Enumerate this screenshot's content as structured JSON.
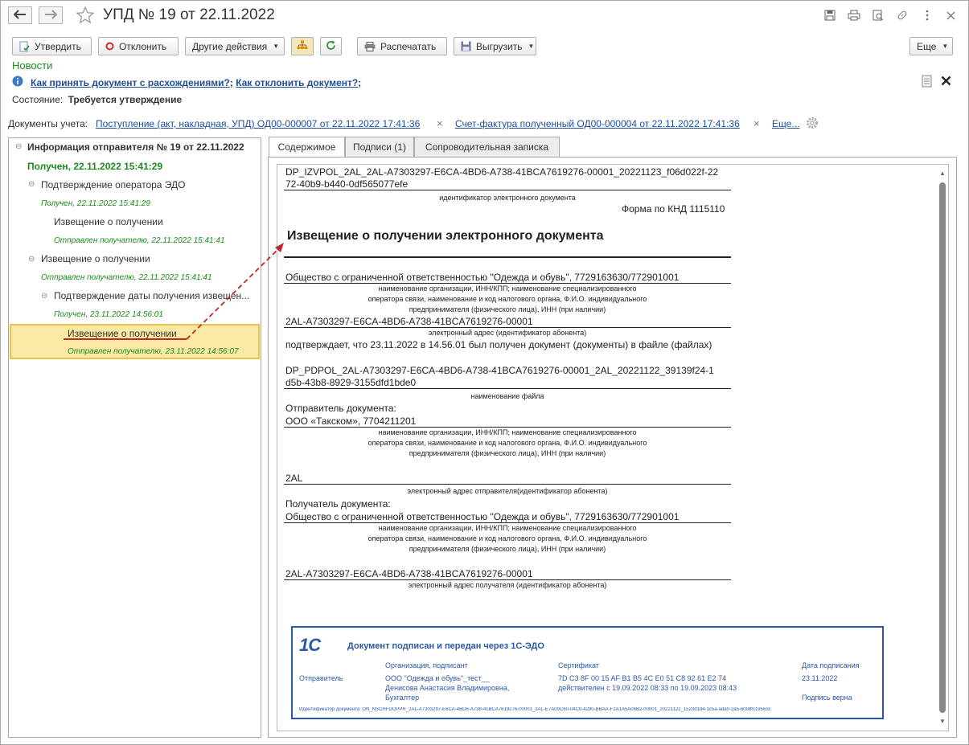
{
  "window": {
    "title": "УПД № 19 от 22.11.2022",
    "icons": [
      "back-arrow-icon",
      "forward-arrow-icon",
      "star-icon",
      "save-icon",
      "print-icon",
      "preview-icon",
      "link-icon",
      "more-vert-icon",
      "close-icon"
    ]
  },
  "toolbar": {
    "approve": "Утвердить",
    "reject": "Отклонить",
    "other_actions": "Другие действия",
    "print": "Распечатать",
    "export": "Выгрузить",
    "more": "Еще"
  },
  "news": {
    "label": "Новости",
    "link1": "Как принять документ с расхождениями?",
    "sep1": ";",
    "link2": "Как отклонить документ?",
    "sep2": ";"
  },
  "state": {
    "label": "Состояние:",
    "value": "Требуется утверждение"
  },
  "docs": {
    "label": "Документы учета:",
    "doc1": "Поступление (акт, накладная, УПД) ОД00-000007 от 22.11.2022 17:41:36",
    "doc2": "Счет-фактура полученный ОД00-000004 от 22.11.2022 17:41:36",
    "more": "Еще..."
  },
  "tree": {
    "root": "Информация отправителя № 19 от 22.11.2022",
    "root_status": "Получен, 22.11.2022 15:41:29",
    "n1": "Подтверждение оператора ЭДО",
    "n1_status": "Получен, 22.11.2022 15:41:29",
    "n1a": "Извещение о получении",
    "n1a_status": "Отправлен получателю, 22.11.2022 15:41:41",
    "n2": "Извещение о получении",
    "n2_status": "Отправлен получателю, 22.11.2022 15:41:41",
    "n3": "Подтверждение даты получения извещен...",
    "n3_status": "Получен, 23.11.2022 14:56:01",
    "n3a": "Извещение о получении",
    "n3a_status": "Отправлен получателю, 23.11.2022 14:56:07"
  },
  "tabs": [
    "Содержимое",
    "Подписи (1)",
    "Сопроводительная записка"
  ],
  "document": {
    "file_id_1": "DP_IZVPOL_2AL_2AL-A7303297-E6CA-4BD6-A738-41BCA7619276-00001_20221123_f06d022f-22",
    "file_id_2": "72-40b9-b440-0df565077efe",
    "file_id_caption": "идентификатор электронного документа",
    "form": "Форма по КНД 1115110",
    "heading": "Извещение о получении электронного документа",
    "org": "Общество с ограниченной ответственностью \"Одежда и обувь\", 7729163630/772901001",
    "org_caption_1": "наименование организации, ИНН/КПП; наименование специализированного",
    "org_caption_2": "оператора связи, наименование и код налогового органа, Ф.И.О. индивидуального",
    "org_caption_3": "предпринимателя (физического лица), ИНН (при наличии)",
    "address": "2AL-A7303297-E6CA-4BD6-A738-41BCA7619276-00001",
    "address_caption": "электронный адрес (идентификатор абонента)",
    "confirm": "подтверждает, что 23.11.2022 в 14.56.01 был получен документ (документы) в файле (файлах)",
    "file_1": "DP_PDPOL_2AL-A7303297-E6CA-4BD6-A738-41BCA7619276-00001_2AL_20221122_39139f24-1",
    "file_2": "d5b-43b8-8929-3155dfd1bde0",
    "file_caption": "наименование файла",
    "sender_label": "Отправитель документа:",
    "sender": "ООО «Такском», 7704211201",
    "sender_caption_1": "наименование организации, ИНН/КПП; наименование специализированного",
    "sender_caption_2": "оператора связи, наименование и код налогового органа, Ф.И.О. индивидуального",
    "sender_caption_3": "предпринимателя (физического лица), ИНН (при наличии)",
    "sender_addr": "2AL",
    "sender_addr_caption": "электронный адрес отправителя(идентификатор абонента)",
    "recipient_label": "Получатель документа:",
    "recipient": "Общество с ограниченной ответственностью \"Одежда и обувь\", 7729163630/772901001",
    "recipient_caption_1": "наименование организации, ИНН/КПП; наименование специализированного",
    "recipient_caption_2": "оператора связи, наименование и код налогового органа, Ф.И.О. индивидуального",
    "recipient_caption_3": "предпринимателя (физического лица), ИНН (при наличии)",
    "recipient_addr": "2AL-A7303297-E6CA-4BD6-A738-41BCA7619276-00001",
    "recipient_addr_caption": "электронный адрес получателя (идентификатор абонента)"
  },
  "stamp": {
    "logo": "1С",
    "title": "Документ подписан и передан через 1С-ЭДО",
    "col_org": "Организация, подписант",
    "col_cert": "Сертификат",
    "col_date": "Дата подписания",
    "sender_label": "Отправитель",
    "org_1": "ООО \"Одежда и обувь\"_тест__",
    "org_2": "Денисова Анастасия Владимировна,",
    "org_3": "Бухгалтер",
    "cert_1": "7D C3 8F 00 15 AF B1 B5 4C E0 51 C8 92 61 E2 74",
    "cert_2": "действителен с 19.09.2022 08:33 по 19.09.2023 08:43",
    "date": "23.11.2022",
    "sign_status": "Подпись верна",
    "doc_id": "Идентификатор документа: ON_NSCHFDOPPR_2AL-A7303297-E6CA-4BD6-A738-41BCA7619276-00001_2AL-E7A00C60-04C0-4290-BBAA-F2A1A5A06B2-00001_20221122_1523d1d4-1c5a-ada0-2a5-6008fc19563c"
  },
  "colors": {
    "accent_green": "#1b8a1b",
    "link_blue": "#1f4e99",
    "selection_yellow": "#fbe8a2",
    "stamp_blue": "#2a58a8",
    "annotation_red": "#c0262b"
  }
}
